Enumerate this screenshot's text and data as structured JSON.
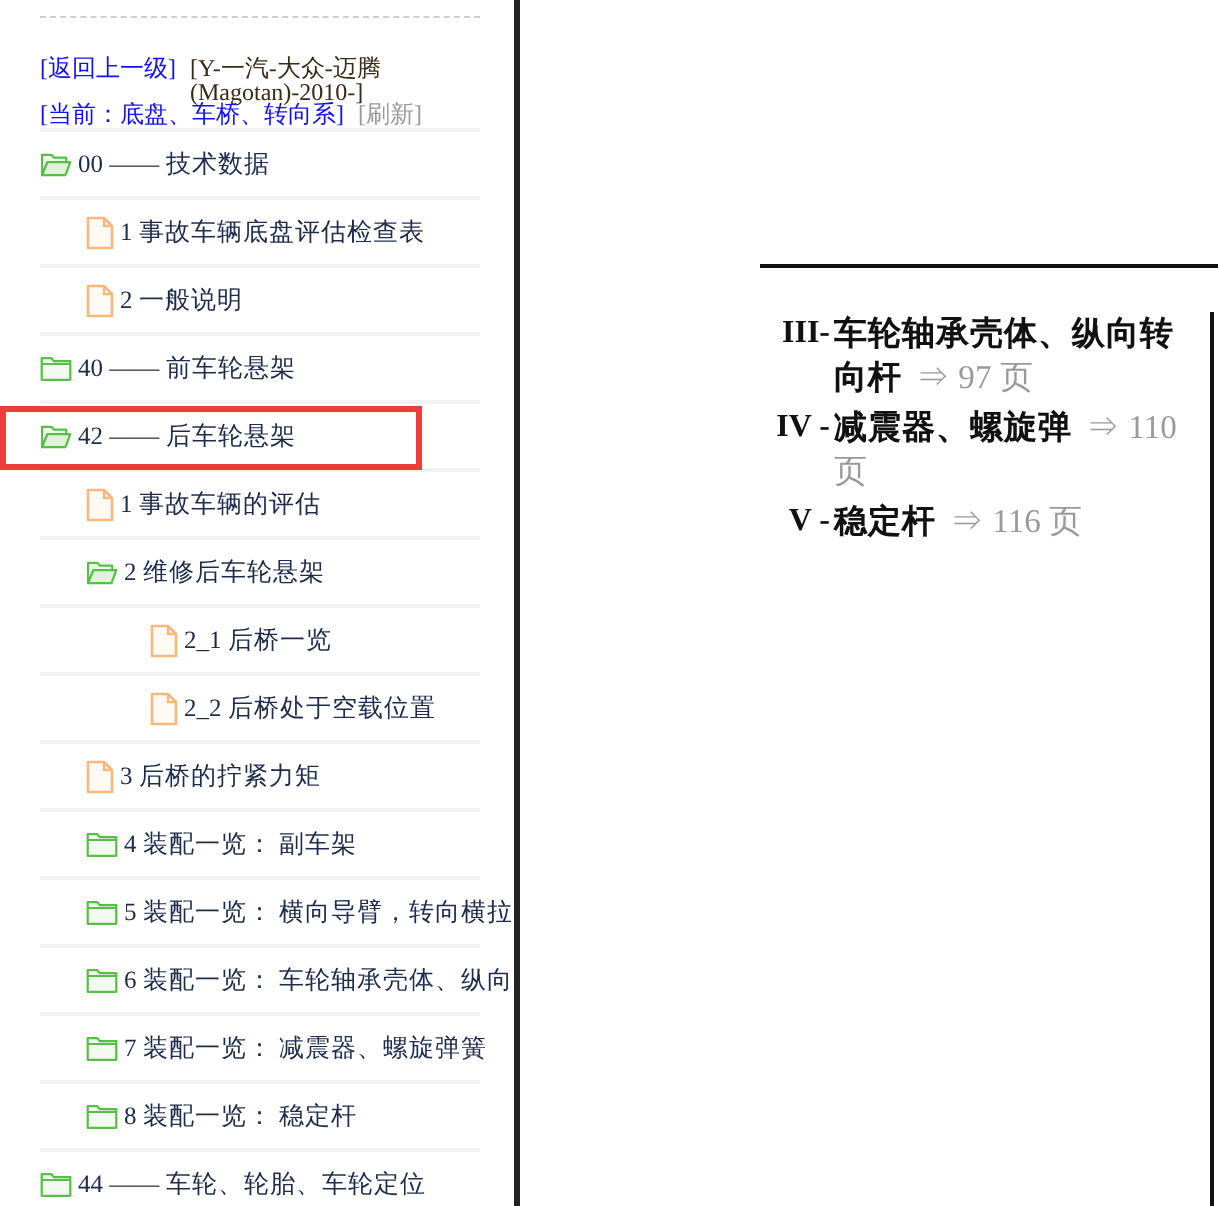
{
  "header": {
    "back_link": "[返回上一级]",
    "breadcrumb": "[Y-一汽-大众-迈腾(Magotan)-2010-]",
    "current_section": "[当前：底盘、车桥、转向系]",
    "refresh_link": "[刷新]"
  },
  "tree": [
    {
      "kind": "folder",
      "label": "00 —— 技术数据",
      "expanded": true,
      "selected": false,
      "children": [
        {
          "kind": "file",
          "label": "1 事故车辆底盘评估检查表",
          "selected": false
        },
        {
          "kind": "file",
          "label": "2 一般说明",
          "selected": false
        }
      ]
    },
    {
      "kind": "folder",
      "label": "40 —— 前车轮悬架",
      "expanded": false,
      "selected": false
    },
    {
      "kind": "folder",
      "label": "42 —— 后车轮悬架",
      "expanded": true,
      "selected": true,
      "children": [
        {
          "kind": "file",
          "label": "1 事故车辆的评估",
          "selected": false
        },
        {
          "kind": "folder",
          "label": "2 维修后车轮悬架",
          "expanded": true,
          "selected": false,
          "children": [
            {
              "kind": "file",
              "label": "2_1 后桥一览",
              "selected": false
            },
            {
              "kind": "file",
              "label": "2_2 后桥处于空载位置",
              "selected": false
            }
          ]
        },
        {
          "kind": "file",
          "label": "3 后桥的拧紧力矩",
          "selected": false
        },
        {
          "kind": "folder",
          "label": "4 装配一览： 副车架",
          "expanded": false,
          "selected": false
        },
        {
          "kind": "folder",
          "label": "5 装配一览： 横向导臂，转向横拉",
          "expanded": false,
          "selected": false
        },
        {
          "kind": "folder",
          "label": "6 装配一览： 车轮轴承壳体、纵向",
          "expanded": false,
          "selected": false
        },
        {
          "kind": "folder",
          "label": "7 装配一览： 减震器、螺旋弹簧",
          "expanded": false,
          "selected": false
        },
        {
          "kind": "folder",
          "label": "8 装配一览： 稳定杆",
          "expanded": false,
          "selected": false
        }
      ]
    },
    {
      "kind": "folder",
      "label": "44 —— 车轮、轮胎、车轮定位",
      "expanded": false,
      "selected": false
    }
  ],
  "document": {
    "toc": [
      {
        "numeral": "III-",
        "title": "车轮轴承壳体、纵向转向杆",
        "page_ref": "⇒ 97 页"
      },
      {
        "numeral": "IV -",
        "title": "减震器、螺旋弹",
        "page_ref": "⇒ 110 页"
      },
      {
        "numeral": "V -",
        "title": "稳定杆",
        "page_ref": "⇒ 116 页"
      }
    ]
  }
}
